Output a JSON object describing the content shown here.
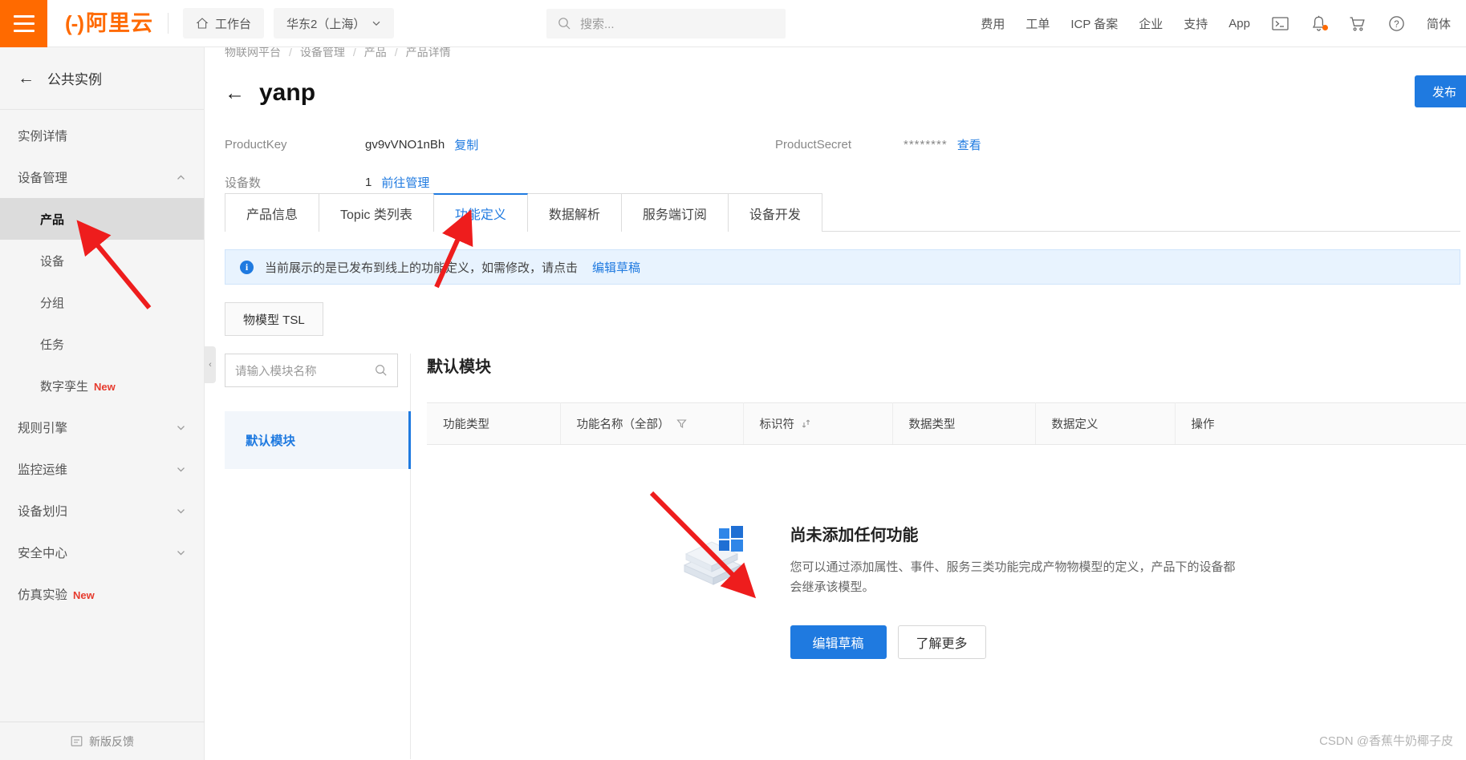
{
  "header": {
    "menu_icon": "hamburger-icon",
    "brand_mark": "(-)",
    "brand_name": "阿里云",
    "workbench": {
      "icon": "home-icon",
      "label": "工作台"
    },
    "region": {
      "label": "华东2（上海）",
      "icon": "chevron-down-icon"
    },
    "search": {
      "icon": "search-icon",
      "placeholder": "搜索..."
    },
    "links": [
      "费用",
      "工单",
      "ICP 备案",
      "企业",
      "支持",
      "App"
    ],
    "icons": [
      {
        "name": "terminal-icon",
        "glyph": "⌨"
      },
      {
        "name": "bell-icon",
        "glyph": "⚑",
        "badge": true
      },
      {
        "name": "cart-icon",
        "glyph": "Ὥ2"
      },
      {
        "name": "help-icon",
        "glyph": "?"
      }
    ],
    "language": "简体"
  },
  "sidebar": {
    "back": {
      "icon": "arrow-left-icon",
      "label": "公共实例"
    },
    "items": [
      {
        "label": "实例详情",
        "level": "top",
        "expandable": false,
        "active": false
      },
      {
        "label": "设备管理",
        "level": "top",
        "expandable": true,
        "chevron": "chevron-up-icon",
        "active": false
      },
      {
        "label": "产品",
        "level": "sub",
        "expandable": false,
        "active": true
      },
      {
        "label": "设备",
        "level": "sub",
        "expandable": false,
        "active": false
      },
      {
        "label": "分组",
        "level": "sub",
        "expandable": false,
        "active": false
      },
      {
        "label": "任务",
        "level": "sub",
        "expandable": false,
        "active": false
      },
      {
        "label": "数字孪生",
        "level": "sub",
        "expandable": false,
        "active": false,
        "badge": "New"
      },
      {
        "label": "规则引擎",
        "level": "top",
        "expandable": true,
        "chevron": "chevron-down-icon",
        "active": false
      },
      {
        "label": "监控运维",
        "level": "top",
        "expandable": true,
        "chevron": "chevron-down-icon",
        "active": false
      },
      {
        "label": "设备划归",
        "level": "top",
        "expandable": true,
        "chevron": "chevron-down-icon",
        "active": false
      },
      {
        "label": "安全中心",
        "level": "top",
        "expandable": true,
        "chevron": "chevron-down-icon",
        "active": false
      },
      {
        "label": "仿真实验",
        "level": "top",
        "expandable": false,
        "active": false,
        "badge": "New"
      }
    ],
    "footer": {
      "icon": "feedback-icon",
      "label": "新版反馈"
    },
    "collapse_handle": "‹"
  },
  "breadcrumb": [
    "物联网平台",
    "设备管理",
    "产品",
    "产品详情"
  ],
  "page": {
    "back_icon": "arrow-left-icon",
    "title": "yanp",
    "publish_button": "发布"
  },
  "meta": {
    "productkey_label": "ProductKey",
    "productkey_value": "gv9vVNO1nBh",
    "copy_link": "复制",
    "productsecret_label": "ProductSecret",
    "productsecret_value": "********",
    "view_link": "查看",
    "device_count_label": "设备数",
    "device_count_value": "1",
    "manage_link": "前往管理"
  },
  "tabs": [
    {
      "label": "产品信息",
      "active": false
    },
    {
      "label": "Topic 类列表",
      "active": false
    },
    {
      "label": "功能定义",
      "active": true
    },
    {
      "label": "数据解析",
      "active": false
    },
    {
      "label": "服务端订阅",
      "active": false
    },
    {
      "label": "设备开发",
      "active": false
    }
  ],
  "alert": {
    "icon": "info-icon",
    "text": "当前展示的是已发布到线上的功能定义，如需修改，请点击",
    "link": "编辑草稿"
  },
  "tsl_tab": "物模型 TSL",
  "module_panel": {
    "search_placeholder": "请输入模块名称",
    "search_icon": "search-icon",
    "items": [
      {
        "label": "默认模块",
        "active": true
      }
    ]
  },
  "module_content": {
    "title": "默认模块",
    "table_headers": [
      {
        "label": "功能类型",
        "icon": ""
      },
      {
        "label": "功能名称（全部）",
        "icon": "filter-icon"
      },
      {
        "label": "标识符",
        "icon": "sort-icon"
      },
      {
        "label": "数据类型",
        "icon": ""
      },
      {
        "label": "数据定义",
        "icon": ""
      },
      {
        "label": "操作",
        "icon": ""
      }
    ],
    "empty": {
      "illustration": "empty-box-illustration",
      "title": "尚未添加任何功能",
      "description": "您可以通过添加属性、事件、服务三类功能完成产物物模型的定义，产品下的设备都会继承该模型。",
      "primary_button": "编辑草稿",
      "secondary_button": "了解更多"
    }
  },
  "watermark": "CSDN @香蕉牛奶椰子皮",
  "colors": {
    "brand_orange": "#ff6a00",
    "link_blue": "#1f7ae0",
    "alert_bg": "#e8f3fe",
    "sidebar_bg": "#f5f5f5",
    "active_item_bg": "#dcdcdc",
    "badge_red": "#e63b2e",
    "annotation_red": "#ee1d1d"
  }
}
